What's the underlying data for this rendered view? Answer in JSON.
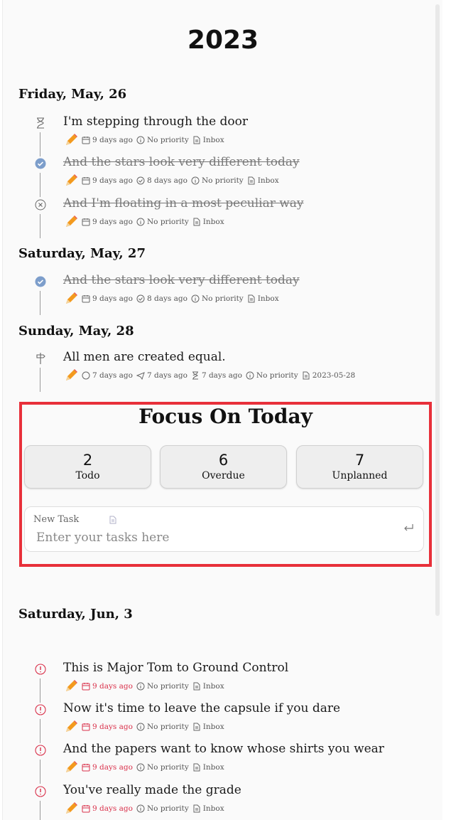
{
  "year": "2023",
  "days": [
    {
      "heading": "Friday, May, 26",
      "tasks": [
        {
          "title": "I'm stepping through the door",
          "status": "hourglass-icon",
          "meta": [
            "9 days ago",
            "No priority",
            "Inbox"
          ]
        },
        {
          "title": "And the stars look very different today",
          "status": "check-circle-icon",
          "done": true,
          "meta": [
            "9 days ago",
            "8 days ago",
            "No priority",
            "Inbox"
          ]
        },
        {
          "title": "And I'm floating in a most peculiar way",
          "status": "cancel-circle-icon",
          "done": true,
          "meta": [
            "9 days ago",
            "No priority",
            "Inbox"
          ]
        }
      ]
    },
    {
      "heading": "Saturday, May, 27",
      "tasks": [
        {
          "title": "And the stars look very different today",
          "status": "check-circle-icon",
          "done": true,
          "meta": [
            "9 days ago",
            "8 days ago",
            "No priority",
            "Inbox"
          ]
        }
      ]
    },
    {
      "heading": "Sunday, May, 28",
      "tasks": [
        {
          "title": "All men are created equal.",
          "status": "signpost-icon",
          "meta": [
            "7 days ago",
            "7 days ago",
            "7 days ago",
            "No priority",
            "2023-05-28"
          ]
        }
      ]
    },
    {
      "heading": "Saturday, Jun, 3",
      "tasks": [
        {
          "title": "This is Major Tom to Ground Control",
          "status": "alert-circle-icon",
          "meta": [
            "9 days ago",
            "No priority",
            "Inbox"
          ]
        },
        {
          "title": "Now it's time to leave the capsule if you dare",
          "status": "alert-circle-icon",
          "meta": [
            "9 days ago",
            "No priority",
            "Inbox"
          ]
        },
        {
          "title": "And the papers want to know whose shirts you wear",
          "status": "alert-circle-icon",
          "meta": [
            "9 days ago",
            "No priority",
            "Inbox"
          ]
        },
        {
          "title": "You've really made the grade",
          "status": "alert-circle-icon",
          "meta": [
            "9 days ago",
            "No priority",
            "Inbox"
          ]
        }
      ]
    }
  ],
  "focus": {
    "title": "Focus On Today",
    "stats": [
      {
        "count": "2",
        "label": "Todo"
      },
      {
        "count": "6",
        "label": "Overdue"
      },
      {
        "count": "7",
        "label": "Unplanned"
      }
    ],
    "new_task_label": "New Task",
    "new_task_placeholder": "Enter your tasks here"
  },
  "colors": {
    "accent_red": "#e8303a",
    "overdue": "#d9304a",
    "done_check": "#7d9ecb"
  }
}
